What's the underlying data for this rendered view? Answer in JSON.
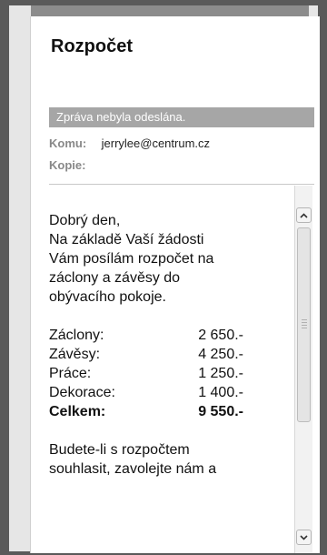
{
  "message": {
    "subject": "Rozpočet",
    "status": "Zpráva nebyla odeslána.",
    "to_label": "Komu:",
    "to_value": "jerrylee@centrum.cz",
    "cc_label": "Kopie:",
    "cc_value": ""
  },
  "body": {
    "lines": [
      "Dobrý den,",
      "Na základě Vaší žádosti",
      "Vám posílám rozpočet na",
      "záclony a závěsy do",
      "obývacího pokoje."
    ],
    "items": [
      {
        "name": "Záclony:",
        "amount": "2 650.-"
      },
      {
        "name": "Závěsy:",
        "amount": "4 250.-"
      },
      {
        "name": "Práce:",
        "amount": "1 250.-"
      },
      {
        "name": "Dekorace:",
        "amount": "1 400.-"
      }
    ],
    "total": {
      "name": "Celkem:",
      "amount": "9 550.-"
    },
    "closing": [
      "Budete-li s rozpočtem",
      "souhlasit, zavolejte nám a"
    ]
  },
  "icons": {
    "scroll_up": "chevron-up-icon",
    "scroll_down": "chevron-down-icon"
  }
}
